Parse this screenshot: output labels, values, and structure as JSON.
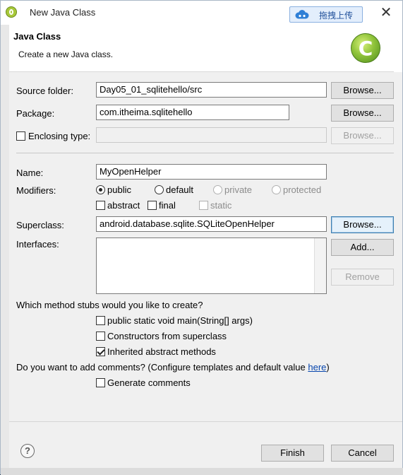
{
  "window": {
    "title": "New Java Class",
    "upload_button_label": "拖拽上传",
    "close_glyph": "✕"
  },
  "header": {
    "title": "Java Class",
    "description": "Create a new Java class.",
    "icon_letter": "C"
  },
  "form": {
    "source_folder": {
      "label": "Source folder:",
      "value": "Day05_01_sqlitehello/src",
      "browse": "Browse..."
    },
    "package": {
      "label": "Package:",
      "value": "com.itheima.sqlitehello",
      "browse": "Browse..."
    },
    "enclosing_type": {
      "label": "Enclosing type:",
      "value": "",
      "browse": "Browse...",
      "checked": false
    },
    "name": {
      "label": "Name:",
      "value": "MyOpenHelper"
    },
    "modifiers": {
      "label": "Modifiers:",
      "access": [
        "public",
        "default",
        "private",
        "protected"
      ],
      "selected": "public",
      "abstract": "abstract",
      "final": "final",
      "static": "static"
    },
    "superclass": {
      "label": "Superclass:",
      "value": "android.database.sqlite.SQLiteOpenHelper",
      "browse": "Browse..."
    },
    "interfaces": {
      "label": "Interfaces:",
      "add": "Add...",
      "remove": "Remove"
    },
    "stubs": {
      "question": "Which method stubs would you like to create?",
      "options": [
        {
          "label": "public static void main(String[] args)",
          "checked": false
        },
        {
          "label": "Constructors from superclass",
          "checked": false
        },
        {
          "label": "Inherited abstract methods",
          "checked": true
        }
      ]
    },
    "comments": {
      "question": "Do you want to add comments? (Configure templates and default value ",
      "link": "here",
      "close_paren": ")",
      "option": "Generate comments",
      "checked": false
    }
  },
  "footer": {
    "help_glyph": "?",
    "finish": "Finish",
    "cancel": "Cancel"
  }
}
